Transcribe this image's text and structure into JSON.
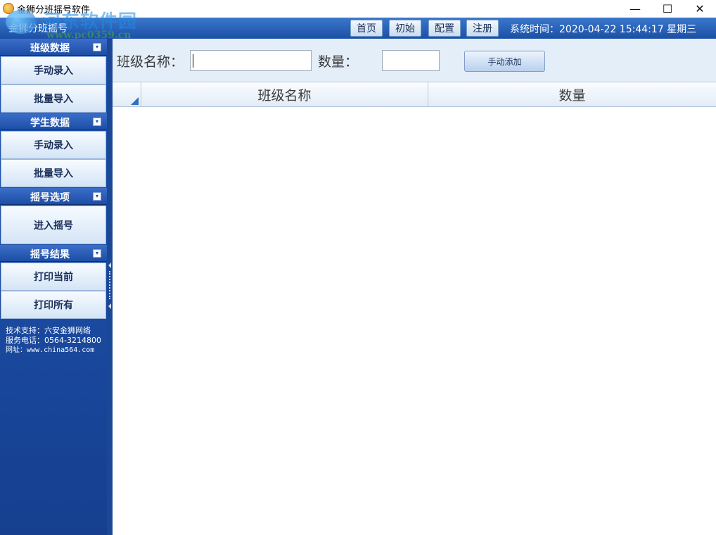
{
  "window": {
    "title": "金狮分班摇号软件",
    "controls": {
      "minimize": "—",
      "maximize": "☐",
      "close": "✕"
    }
  },
  "watermark": {
    "text": "河东软件园",
    "url": "www.pc0359.cn"
  },
  "header": {
    "app_name": "金狮分班摇号",
    "nav": [
      {
        "label": "首页"
      },
      {
        "label": "初始"
      },
      {
        "label": "配置"
      },
      {
        "label": "注册"
      }
    ],
    "system_time": "系统时间：2020-04-22 15:44:17 星期三"
  },
  "sidebar": {
    "groups": [
      {
        "title": "班级数据",
        "toggle": "▾",
        "items": [
          {
            "label": "手动录入"
          },
          {
            "label": "批量导入"
          }
        ]
      },
      {
        "title": "学生数据",
        "toggle": "▾",
        "items": [
          {
            "label": "手动录入"
          },
          {
            "label": "批量导入"
          }
        ]
      },
      {
        "title": "摇号选项",
        "toggle": "▾",
        "items": [
          {
            "label": "进入摇号"
          }
        ]
      },
      {
        "title": "摇号结果",
        "toggle": "▾",
        "items": [
          {
            "label": "打印当前"
          },
          {
            "label": "打印所有"
          }
        ]
      }
    ],
    "support": {
      "tech": "技术支持：六安金狮网络",
      "phone": "服务电话：0564-3214800",
      "website": "网址：www.china564.com"
    }
  },
  "form": {
    "class_name_label": "班级名称：",
    "class_name_value": "",
    "quantity_label": "数量：",
    "quantity_value": "",
    "add_button_label": "手动添加"
  },
  "table": {
    "columns": [
      "班级名称",
      "数量"
    ],
    "rows": []
  },
  "colors": {
    "header_blue": "#1b4fa6",
    "sidebar_blue": "#163f8f",
    "form_bg": "#e4eef9"
  }
}
